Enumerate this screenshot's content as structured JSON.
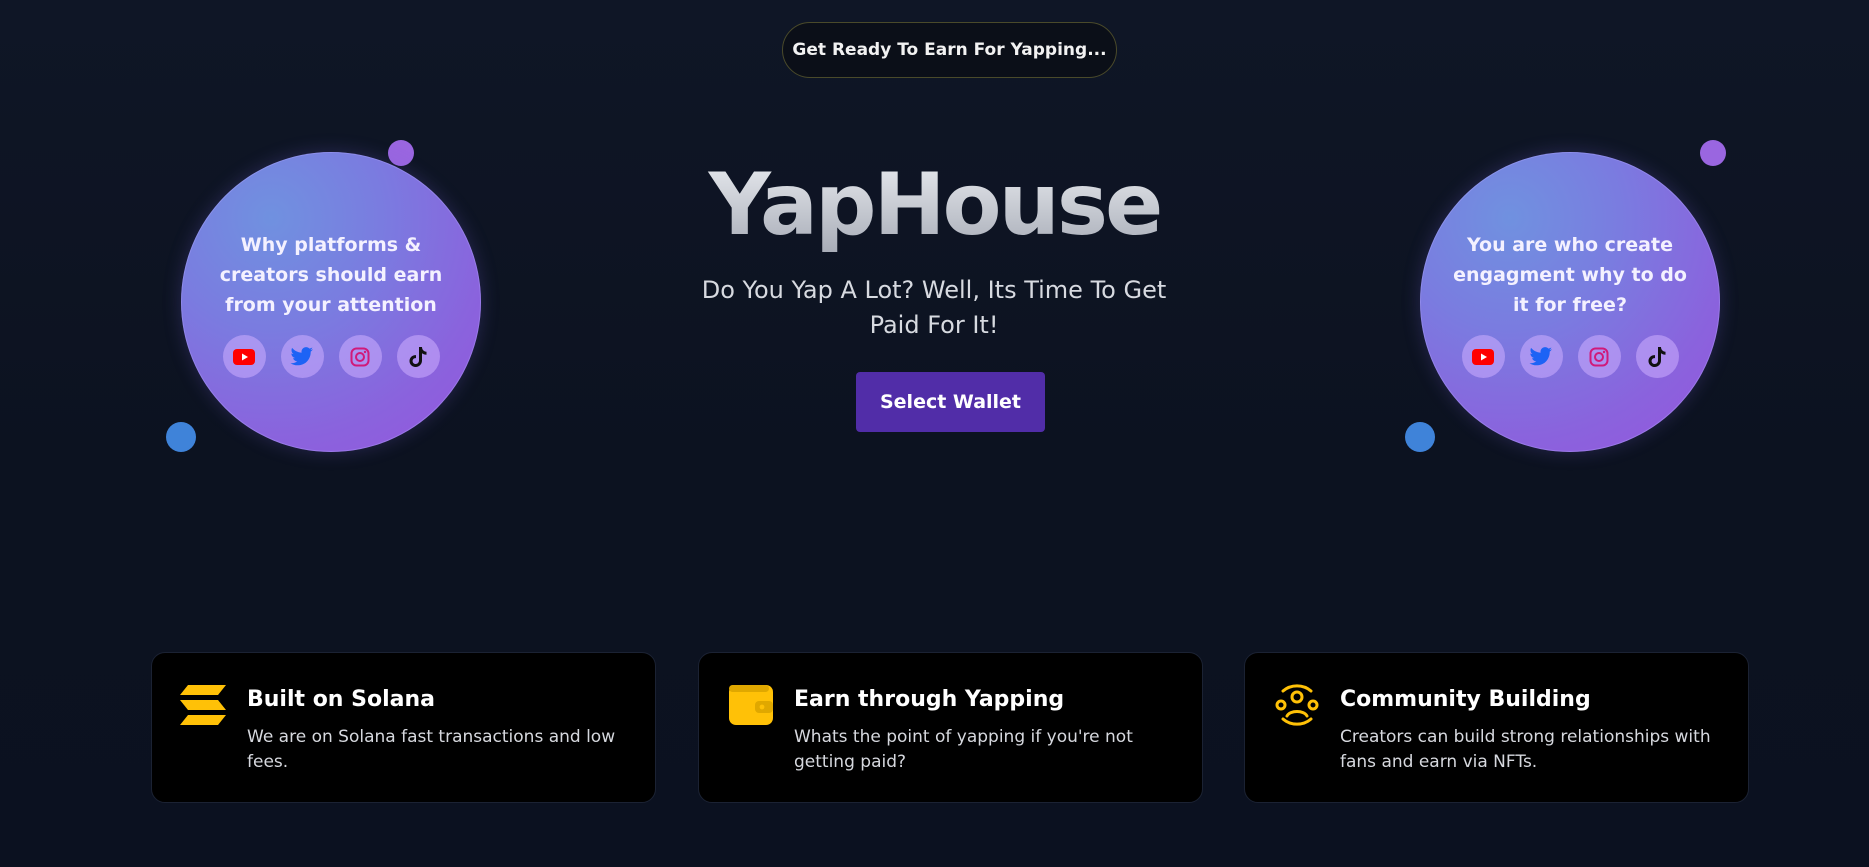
{
  "badge": {
    "label": "Get Ready To Earn For Yapping..."
  },
  "hero": {
    "title": "YapHouse",
    "subtitle": "Do You Yap A Lot? Well, Its Time To Get Paid For It!",
    "wallet_button": "Select Wallet"
  },
  "bubbles": [
    {
      "text": "Why platforms & creators should earn from your attention",
      "socials": [
        "youtube-icon",
        "twitter-icon",
        "instagram-icon",
        "tiktok-icon"
      ]
    },
    {
      "text": "You are who create engagment why to do it for free?",
      "socials": [
        "youtube-icon",
        "twitter-icon",
        "instagram-icon",
        "tiktok-icon"
      ]
    }
  ],
  "features": [
    {
      "icon": "solana-icon",
      "title": "Built on Solana",
      "description": "We are on Solana fast transactions and low fees."
    },
    {
      "icon": "wallet-icon",
      "title": "Earn through Yapping",
      "description": "Whats the point of yapping if you're not getting paid?"
    },
    {
      "icon": "community-icon",
      "title": "Community Building",
      "description": "Creators can build strong relationships with fans and earn via NFTs."
    }
  ],
  "colors": {
    "background": "#0c1220",
    "accent_purple": "#512da8",
    "icon_yellow": "#ffc107",
    "bubble_purple": "#8a63dd",
    "dot_blue": "#3f83d9"
  }
}
